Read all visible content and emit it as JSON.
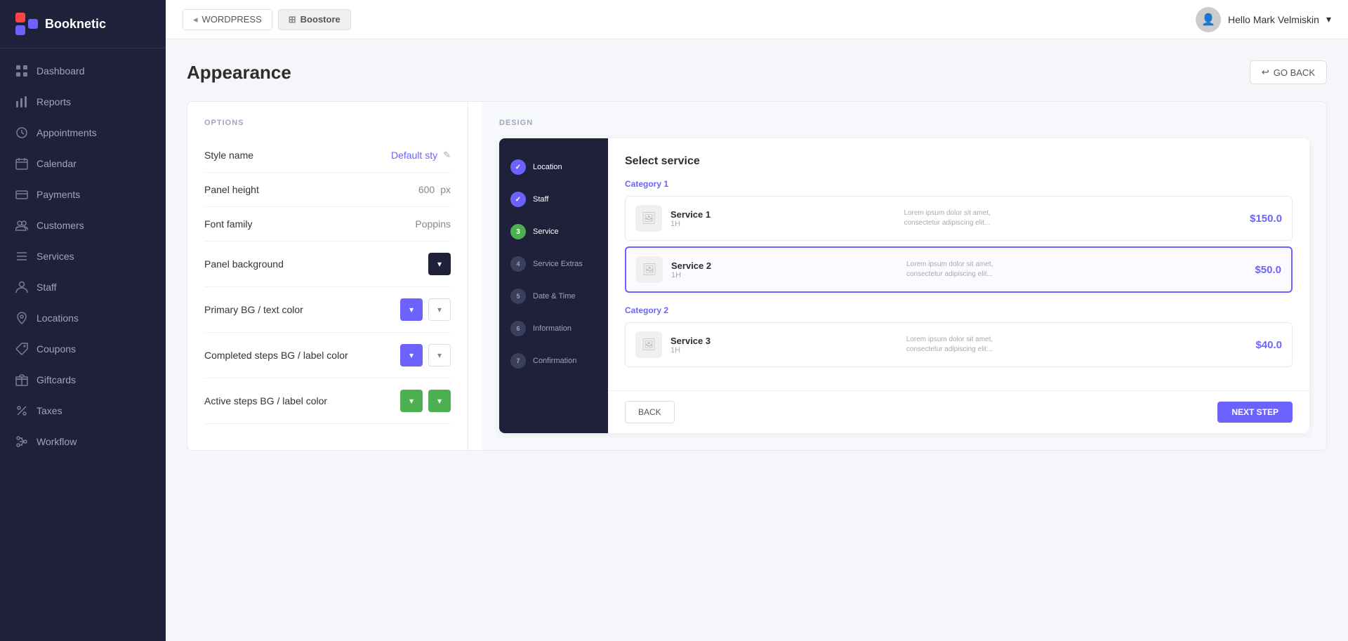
{
  "app": {
    "name": "Booknetic"
  },
  "topbar": {
    "tabs": [
      {
        "id": "wordpress",
        "label": "WORDPRESS",
        "icon": "◂",
        "active": false
      },
      {
        "id": "boostore",
        "label": "Boostore",
        "icon": "⊞",
        "active": true
      }
    ],
    "user": {
      "greeting": "Hello Mark Velmiskin",
      "chevron": "▾"
    }
  },
  "sidebar": {
    "items": [
      {
        "id": "dashboard",
        "label": "Dashboard",
        "icon": "grid"
      },
      {
        "id": "reports",
        "label": "Reports",
        "icon": "chart"
      },
      {
        "id": "appointments",
        "label": "Appointments",
        "icon": "clock"
      },
      {
        "id": "calendar",
        "label": "Calendar",
        "icon": "calendar"
      },
      {
        "id": "payments",
        "label": "Payments",
        "icon": "card"
      },
      {
        "id": "customers",
        "label": "Customers",
        "icon": "people"
      },
      {
        "id": "services",
        "label": "Services",
        "icon": "list"
      },
      {
        "id": "staff",
        "label": "Staff",
        "icon": "person"
      },
      {
        "id": "locations",
        "label": "Locations",
        "icon": "pin"
      },
      {
        "id": "coupons",
        "label": "Coupons",
        "icon": "tag"
      },
      {
        "id": "giftcards",
        "label": "Giftcards",
        "icon": "gift"
      },
      {
        "id": "taxes",
        "label": "Taxes",
        "icon": "percent"
      },
      {
        "id": "workflow",
        "label": "Workflow",
        "icon": "flow"
      }
    ]
  },
  "page": {
    "title": "Appearance",
    "go_back_label": "GO BACK"
  },
  "options": {
    "section_label": "OPTIONS",
    "rows": [
      {
        "id": "style-name",
        "label": "Style name",
        "value": "Default sty",
        "type": "link-edit"
      },
      {
        "id": "panel-height",
        "label": "Panel height",
        "value": "600",
        "unit": "px",
        "type": "number"
      },
      {
        "id": "font-family",
        "label": "Font family",
        "value": "Poppins",
        "type": "text"
      },
      {
        "id": "panel-bg",
        "label": "Panel background",
        "type": "color-dark"
      },
      {
        "id": "primary-bg",
        "label": "Primary BG / text color",
        "type": "color-purple-outline"
      },
      {
        "id": "completed-steps-bg",
        "label": "Completed steps BG / label color",
        "type": "color-purple-outline"
      },
      {
        "id": "active-steps-bg",
        "label": "Active steps BG / label color",
        "type": "color-green-green"
      }
    ]
  },
  "design": {
    "section_label": "DESIGN",
    "preview": {
      "steps": [
        {
          "label": "Location",
          "state": "done",
          "num": "✓"
        },
        {
          "label": "Staff",
          "state": "done",
          "num": "✓"
        },
        {
          "label": "Service",
          "state": "active",
          "num": "3"
        },
        {
          "label": "Service Extras",
          "state": "pending",
          "num": "4"
        },
        {
          "label": "Date & Time",
          "state": "pending",
          "num": "5"
        },
        {
          "label": "Information",
          "state": "pending",
          "num": "6"
        },
        {
          "label": "Confirmation",
          "state": "pending",
          "num": "7"
        }
      ],
      "title": "Select service",
      "categories": [
        {
          "label": "Category 1",
          "services": [
            {
              "name": "Service 1",
              "duration": "1H",
              "desc": "Lorem ipsum dolor sit amet, consectetur adipiscing elit...",
              "price": "$150.0",
              "selected": false
            },
            {
              "name": "Service 2",
              "duration": "1H",
              "desc": "Lorem ipsum dolor sit amet, consectetur adipiscing elit...",
              "price": "$50.0",
              "selected": true
            }
          ]
        },
        {
          "label": "Category 2",
          "services": [
            {
              "name": "Service 3",
              "duration": "1H",
              "desc": "Lorem ipsum dolor sit amet, consectetur adipiscing elit...",
              "price": "$40.0",
              "selected": false
            }
          ]
        }
      ],
      "back_btn": "BACK",
      "next_btn": "NEXT STEP"
    }
  }
}
